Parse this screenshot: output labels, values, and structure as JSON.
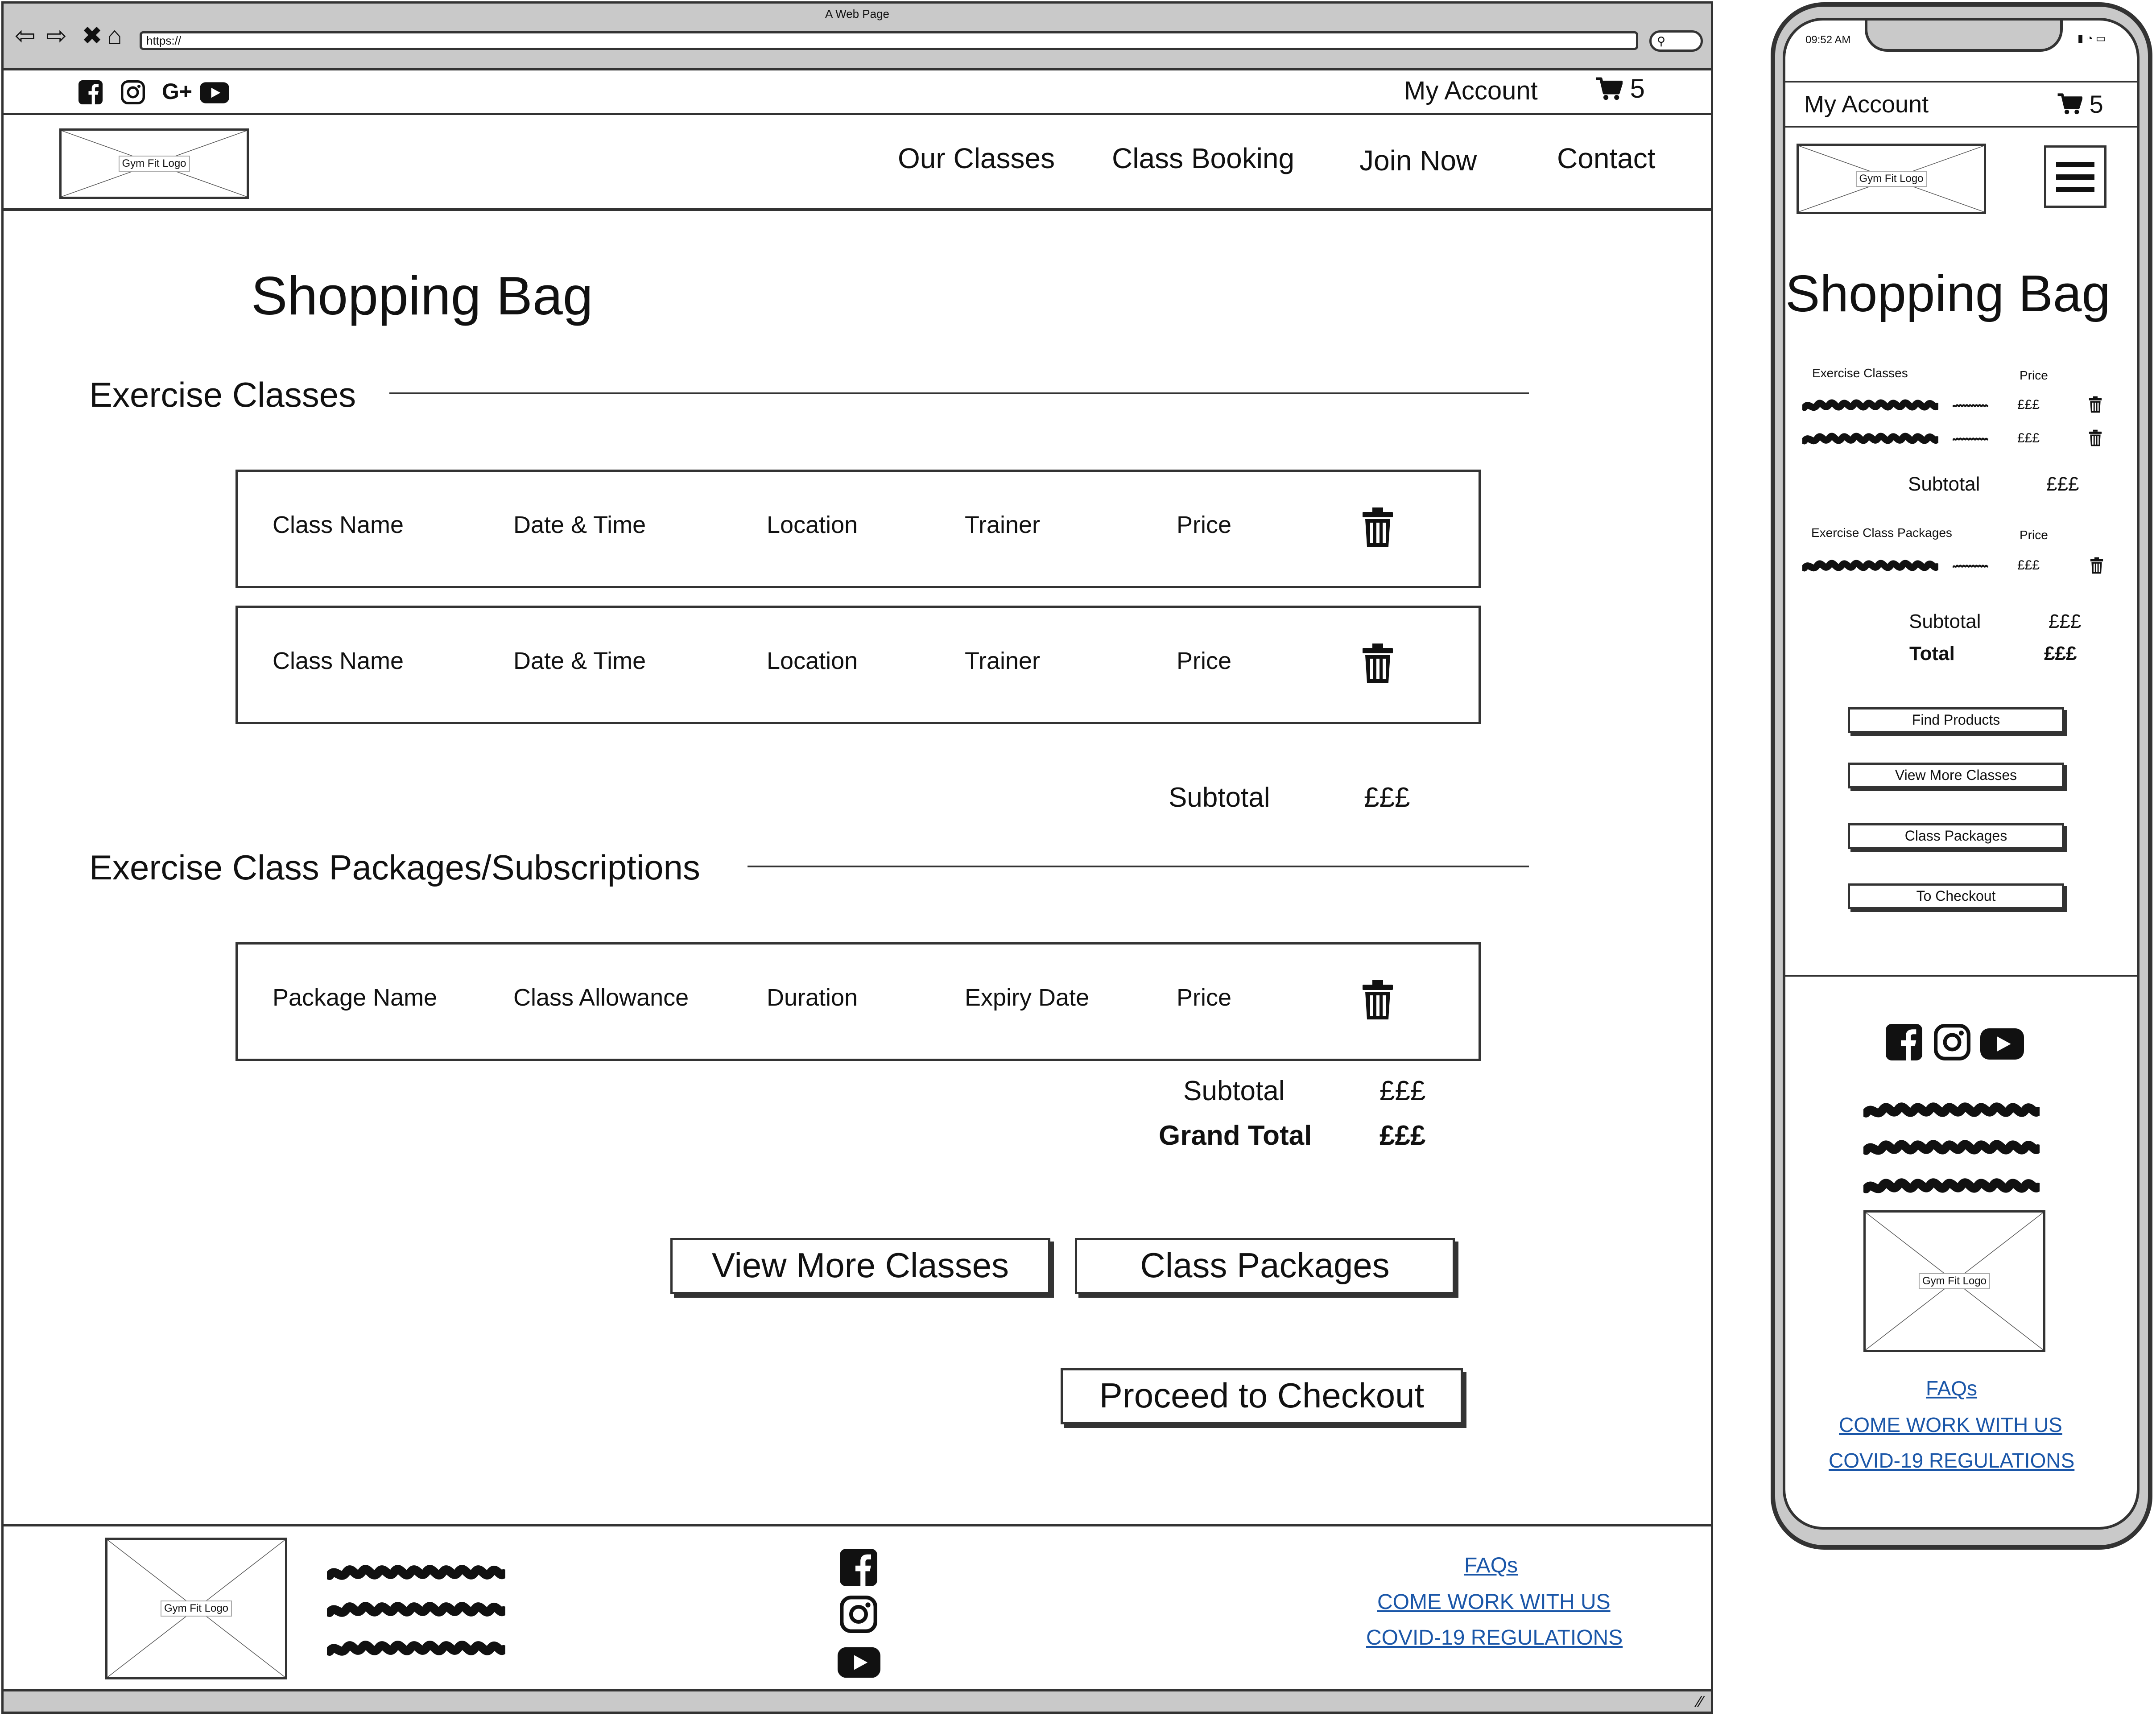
{
  "window": {
    "title": "A Web Page",
    "url": "https://"
  },
  "topbar": {
    "my_account": "My Account",
    "cart_count": "5"
  },
  "nav": {
    "logo": "Gym Fit Logo",
    "links": [
      "Our Classes",
      "Class Booking",
      "Join Now",
      "Contact"
    ]
  },
  "page": {
    "title": "Shopping Bag",
    "classes_section": "Exercise Classes",
    "class_rows": [
      [
        "Class Name",
        "Date & Time",
        "Location",
        "Trainer",
        "Price"
      ],
      [
        "Class Name",
        "Date & Time",
        "Location",
        "Trainer",
        "Price"
      ]
    ],
    "packages_section": "Exercise Class Packages/Subscriptions",
    "package_rows": [
      [
        "Package Name",
        "Class Allowance",
        "Duration",
        "Expiry Date",
        "Price"
      ]
    ],
    "subtotal_label": "Subtotal",
    "subtotal_value": "£££",
    "grand_total_label": "Grand Total",
    "grand_total_value": "£££",
    "buttons": {
      "view_more": "View More Classes",
      "packages": "Class Packages",
      "checkout": "Proceed to Checkout"
    }
  },
  "footer": {
    "logo": "Gym Fit Logo",
    "links": [
      "FAQs",
      "COME WORK WITH US",
      "COVID-19 REGULATIONS"
    ]
  },
  "mobile": {
    "time": "09:52 AM",
    "my_account": "My Account",
    "cart_count": "5",
    "logo": "Gym Fit Logo",
    "title": "Shopping Bag",
    "classes_label": "Exercise Classes",
    "price_label": "Price",
    "packages_label": "Exercise Class Packages",
    "item_price": "£££",
    "subtotal_label": "Subtotal",
    "subtotal_value": "£££",
    "total_label": "Total",
    "total_value": "£££",
    "buttons": [
      "Find Products",
      "View More Classes",
      "Class Packages",
      "To Checkout"
    ],
    "footer_logo": "Gym Fit Logo",
    "footer_links": [
      "FAQs",
      "COME WORK WITH US",
      "COVID-19 REGULATIONS"
    ]
  },
  "icons": {
    "social": [
      "facebook-icon",
      "instagram-icon",
      "google-plus-icon",
      "youtube-icon"
    ],
    "cart": "cart-icon",
    "delete": "trash-icon",
    "menu": "hamburger-menu-icon"
  }
}
